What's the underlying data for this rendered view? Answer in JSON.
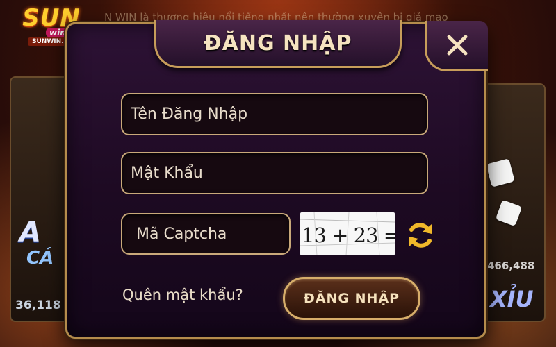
{
  "brand": {
    "name": "SUN",
    "sub": "win",
    "domain": "SUNWIN.ECO"
  },
  "marquee": "N WIN là thương hiệu nổi tiếng nhất nên thường xuyên bị giả mạo",
  "background": {
    "left_game": {
      "label_line1": "A",
      "label_line2": "CÁ",
      "counter": "36,118"
    },
    "right_game": {
      "counter": "466,488",
      "label": "XỈU"
    }
  },
  "login_dialog": {
    "title": "ĐĂNG NHẬP",
    "username": {
      "placeholder": "Tên Đăng Nhập",
      "value": ""
    },
    "password": {
      "placeholder": "Mật Khẩu",
      "value": ""
    },
    "captcha": {
      "placeholder": "Mã Captcha",
      "value": "",
      "image_text": "13 + 23 = ?"
    },
    "forgot_link": "Quên mật khẩu?",
    "submit_label": "ĐĂNG NHẬP"
  },
  "icons": {
    "close": "close-icon",
    "refresh": "refresh-icon"
  },
  "colors": {
    "gold": "#c9a97a",
    "accent": "#f6e2bd",
    "panel": "#1d0a22"
  }
}
